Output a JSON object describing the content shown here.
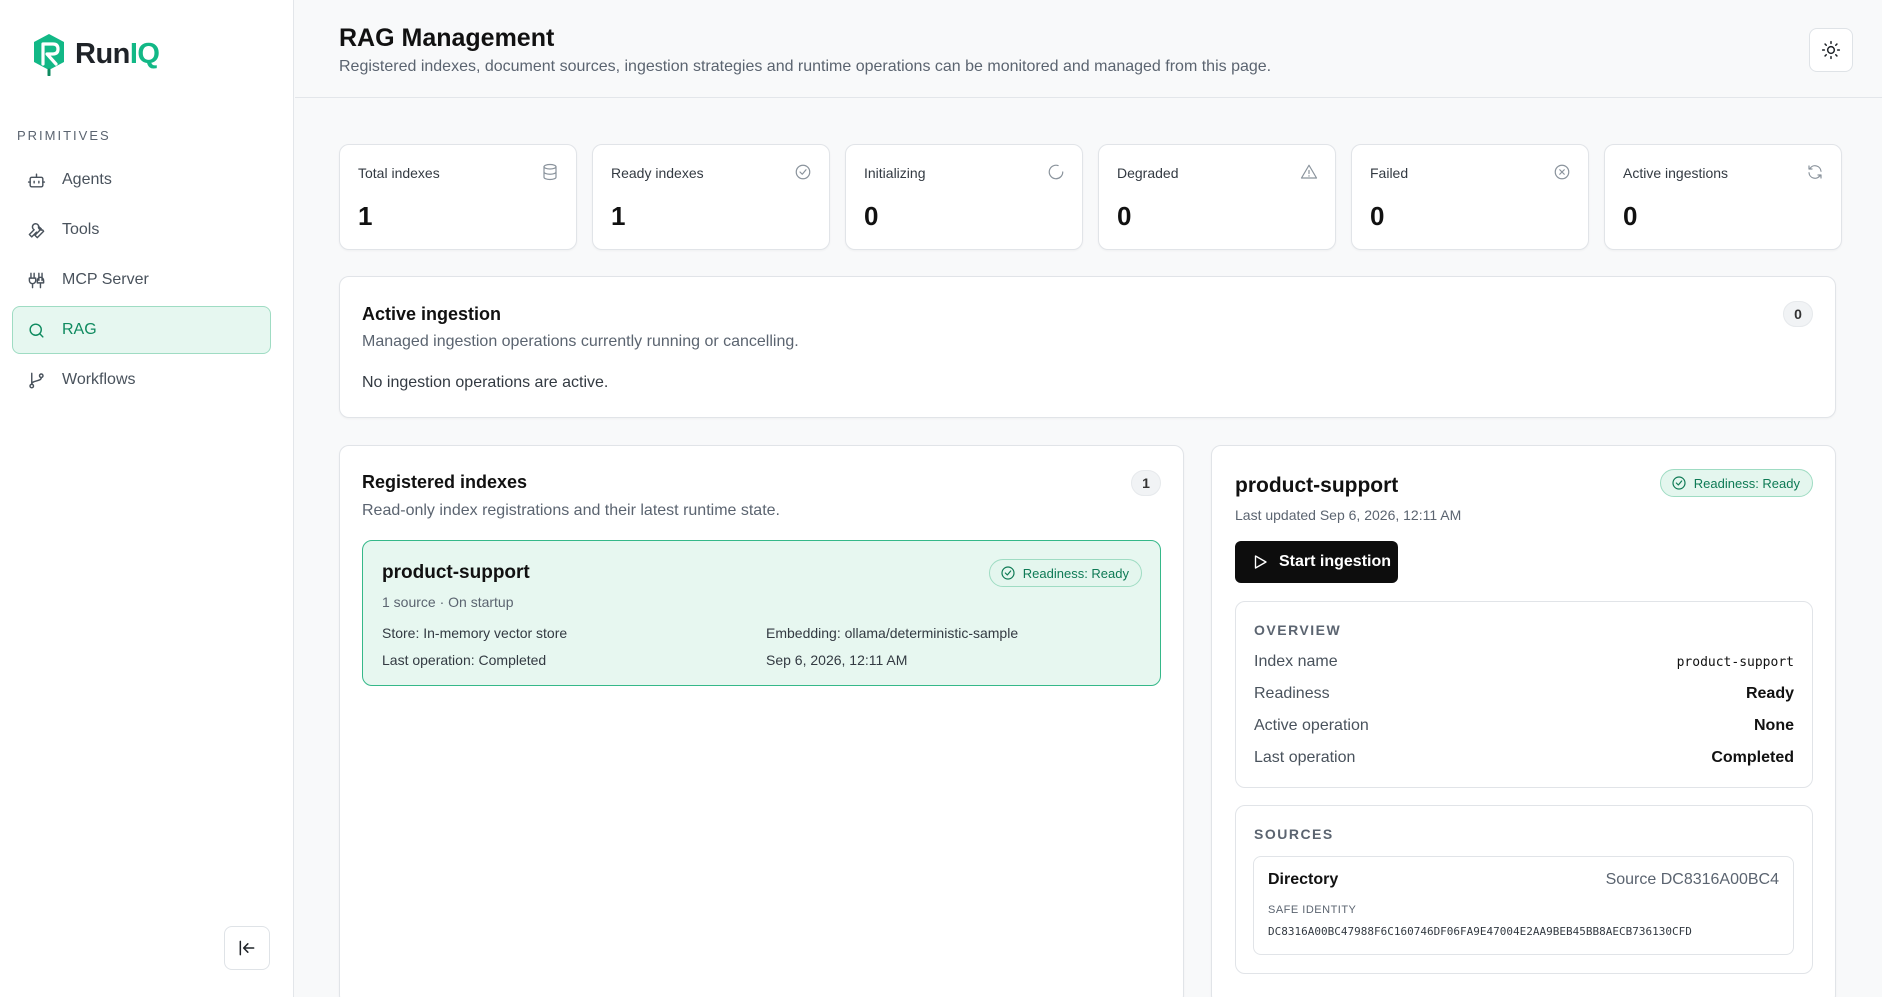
{
  "app": {
    "brand_run": "Run",
    "brand_iq": "IQ"
  },
  "sidebar": {
    "section_label": "PRIMITIVES",
    "items": [
      {
        "label": "Agents",
        "icon": "bot-icon"
      },
      {
        "label": "Tools",
        "icon": "wrench-icon"
      },
      {
        "label": "MCP Server",
        "icon": "plug-icon"
      },
      {
        "label": "RAG",
        "icon": "search-icon",
        "active": true
      },
      {
        "label": "Workflows",
        "icon": "git-branch-icon"
      }
    ]
  },
  "header": {
    "title": "RAG Management",
    "subtitle": "Registered indexes, document sources, ingestion strategies and runtime operations can be monitored and managed from this page."
  },
  "stats": [
    {
      "label": "Total indexes",
      "value": "1",
      "icon": "database-icon"
    },
    {
      "label": "Ready indexes",
      "value": "1",
      "icon": "check-circle-icon"
    },
    {
      "label": "Initializing",
      "value": "0",
      "icon": "loader-icon"
    },
    {
      "label": "Degraded",
      "value": "0",
      "icon": "warning-icon"
    },
    {
      "label": "Failed",
      "value": "0",
      "icon": "x-circle-icon"
    },
    {
      "label": "Active ingestions",
      "value": "0",
      "icon": "refresh-icon"
    }
  ],
  "active_ingestion": {
    "title": "Active ingestion",
    "description": "Managed ingestion operations currently running or cancelling.",
    "count": "0",
    "empty_text": "No ingestion operations are active."
  },
  "registered_indexes": {
    "title": "Registered indexes",
    "description": "Read-only index registrations and their latest runtime state.",
    "count": "1",
    "items": [
      {
        "name": "product-support",
        "readiness": "Readiness: Ready",
        "meta": "1 source · On startup",
        "store": "Store: In-memory vector store",
        "embedding": "Embedding: ollama/deterministic-sample",
        "last_operation": "Last operation: Completed",
        "last_operation_time": "Sep 6, 2026, 12:11 AM"
      }
    ]
  },
  "detail": {
    "name": "product-support",
    "readiness": "Readiness: Ready",
    "last_updated": "Last updated Sep 6, 2026, 12:11 AM",
    "start_button": "Start ingestion",
    "overview": {
      "label": "OVERVIEW",
      "rows": [
        {
          "key": "Index name",
          "value": "product-support"
        },
        {
          "key": "Readiness",
          "value": "Ready"
        },
        {
          "key": "Active operation",
          "value": "None"
        },
        {
          "key": "Last operation",
          "value": "Completed"
        }
      ]
    },
    "sources": {
      "label": "SOURCES",
      "items": [
        {
          "type": "Directory",
          "source_id": "Source DC8316A00BC4",
          "identity_label": "SAFE IDENTITY",
          "identity": "DC8316A00BC47988F6C160746DF06FA9E47004E2AA9BEB45BB8AECB736130CFD"
        }
      ]
    }
  },
  "colors": {
    "accent": "#12b886",
    "accent_dark": "#0e8a5f",
    "active_bg": "#e6f7f0"
  }
}
